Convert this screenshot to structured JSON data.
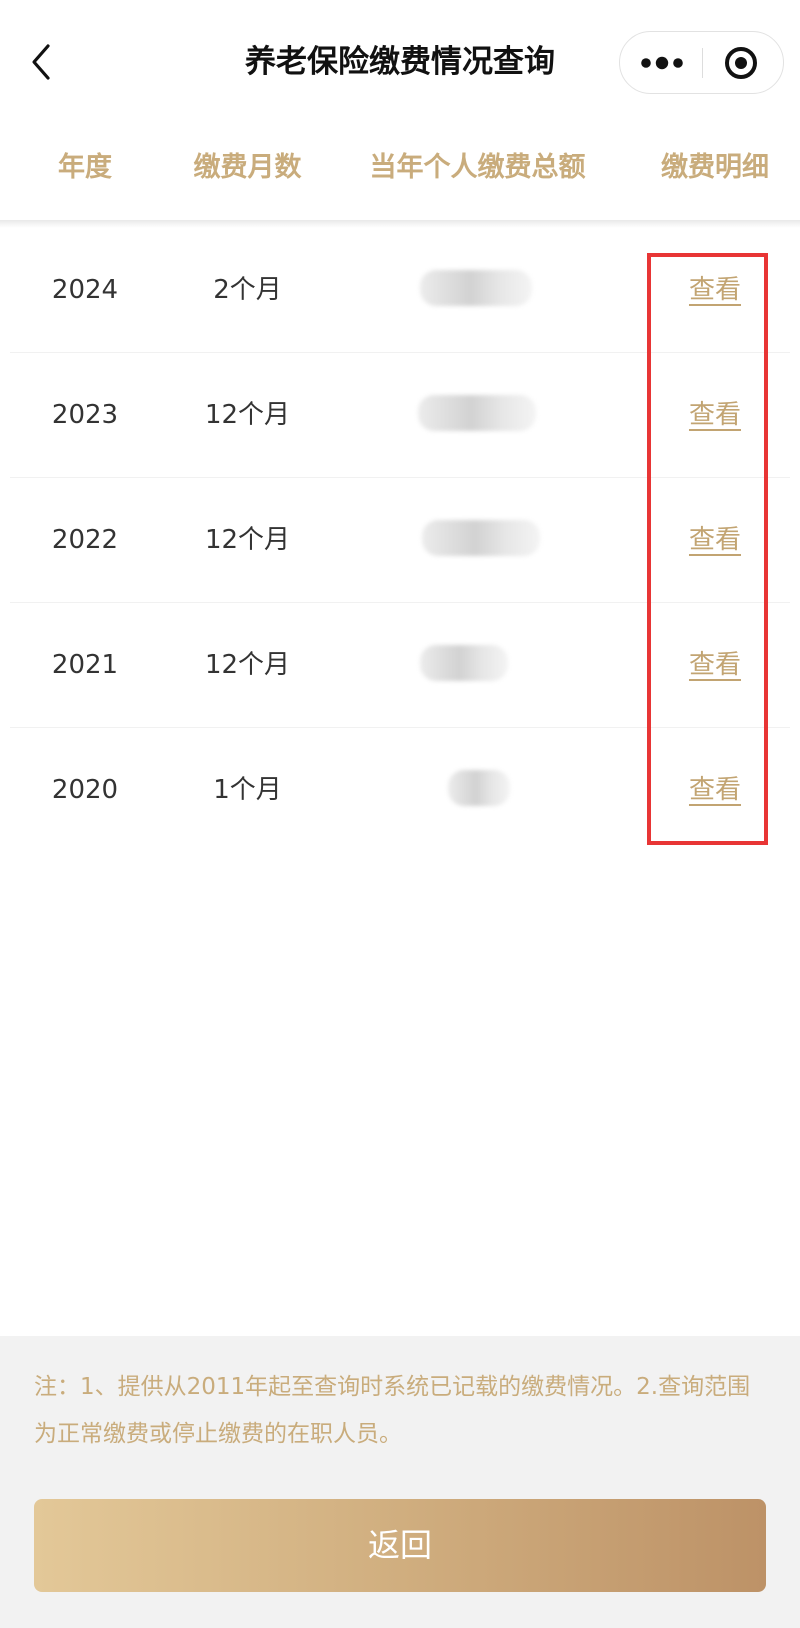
{
  "navbar": {
    "title": "养老保险缴费情况查询",
    "back_icon": "chevron-left-icon",
    "more_icon": "more-dots-icon",
    "close_icon": "target-circle-icon"
  },
  "table": {
    "headers": [
      "年度",
      "缴费月数",
      "当年个人缴费总额",
      "缴费明细"
    ],
    "rows": [
      {
        "year": "2024",
        "months": "2个月",
        "amount": "",
        "detail_label": "查看"
      },
      {
        "year": "2023",
        "months": "12个月",
        "amount": "",
        "detail_label": "查看"
      },
      {
        "year": "2022",
        "months": "12个月",
        "amount": "",
        "detail_label": "查看"
      },
      {
        "year": "2021",
        "months": "12个月",
        "amount": "",
        "detail_label": "查看"
      },
      {
        "year": "2020",
        "months": "1个月",
        "amount": "",
        "detail_label": "查看"
      }
    ]
  },
  "footer": {
    "note": "注：1、提供从2011年起至查询时系统已记载的缴费情况。2.查询范围为正常缴费或停止缴费的在职人员。",
    "return_label": "返回"
  },
  "colors": {
    "accent_gold": "#c9ac7c",
    "link_gold": "#c2a472",
    "highlight_red": "#e83535",
    "button_gradient_start": "#e3c898",
    "button_gradient_end": "#bd9267"
  }
}
